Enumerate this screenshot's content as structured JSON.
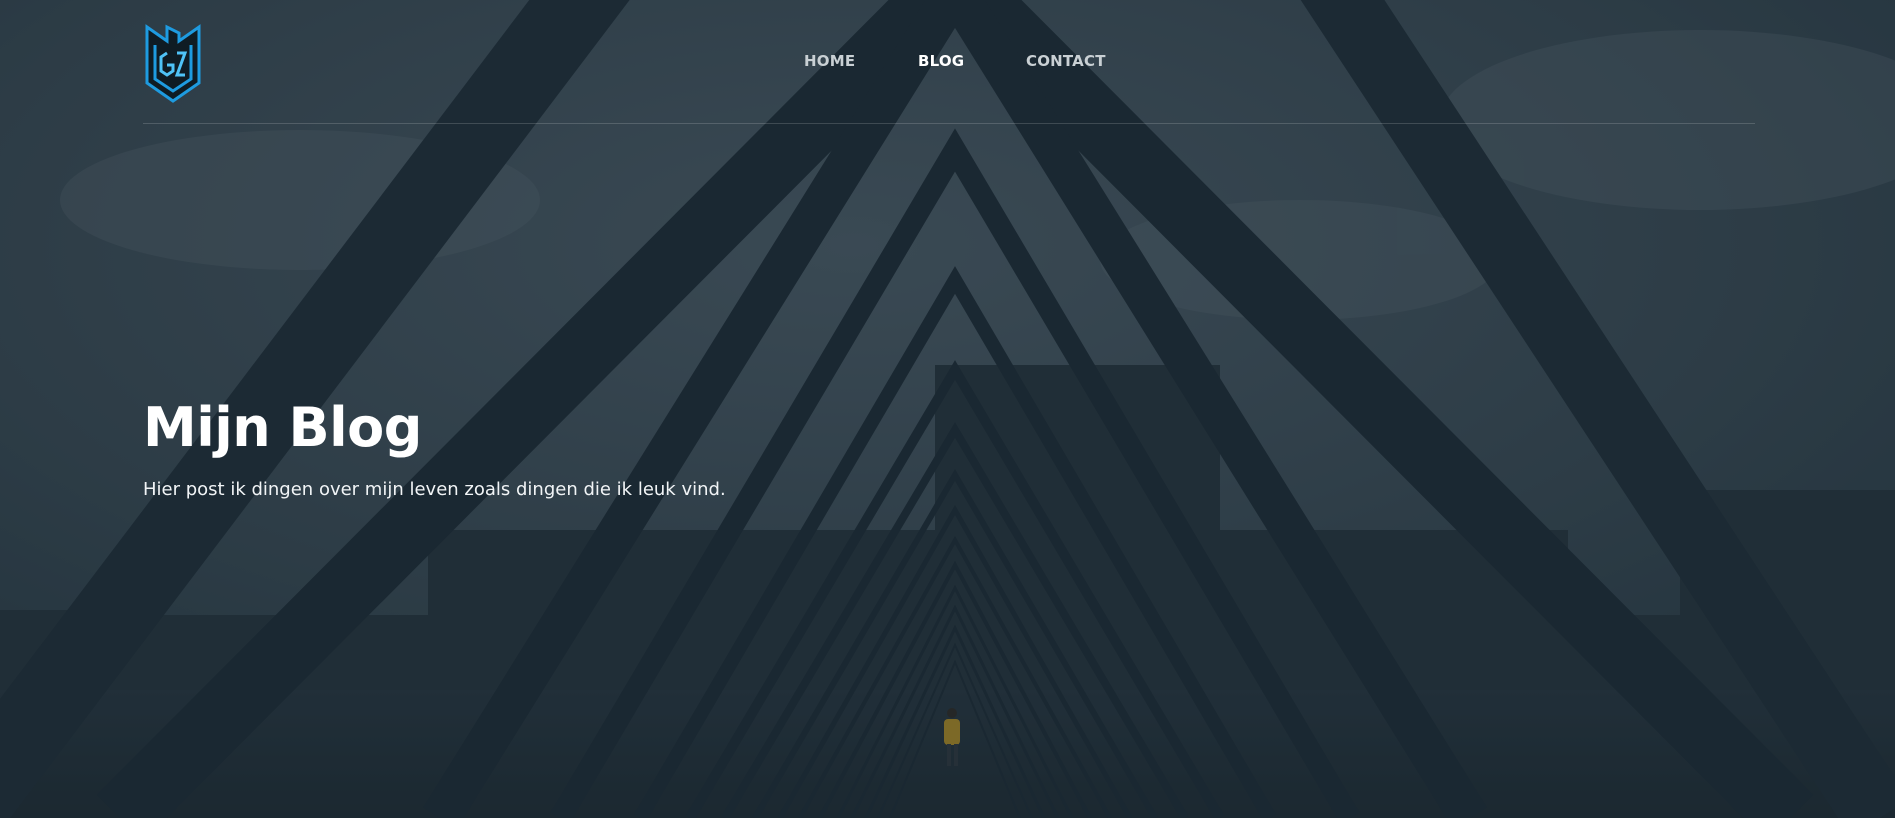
{
  "nav": {
    "items": [
      {
        "label": "HOME",
        "active": false
      },
      {
        "label": "BLOG",
        "active": true
      },
      {
        "label": "CONTACT",
        "active": false
      }
    ]
  },
  "hero": {
    "title": "Mijn Blog",
    "subtitle": "Hier post ik dingen over mijn leven zoals dingen die ik leuk vind."
  },
  "colors": {
    "overlay": "#1e2c36",
    "frame": "#1b2a33",
    "logo_accent": "#1e9be0",
    "text": "#ffffff"
  },
  "logo": {
    "icon": "shield-monogram-icon"
  }
}
